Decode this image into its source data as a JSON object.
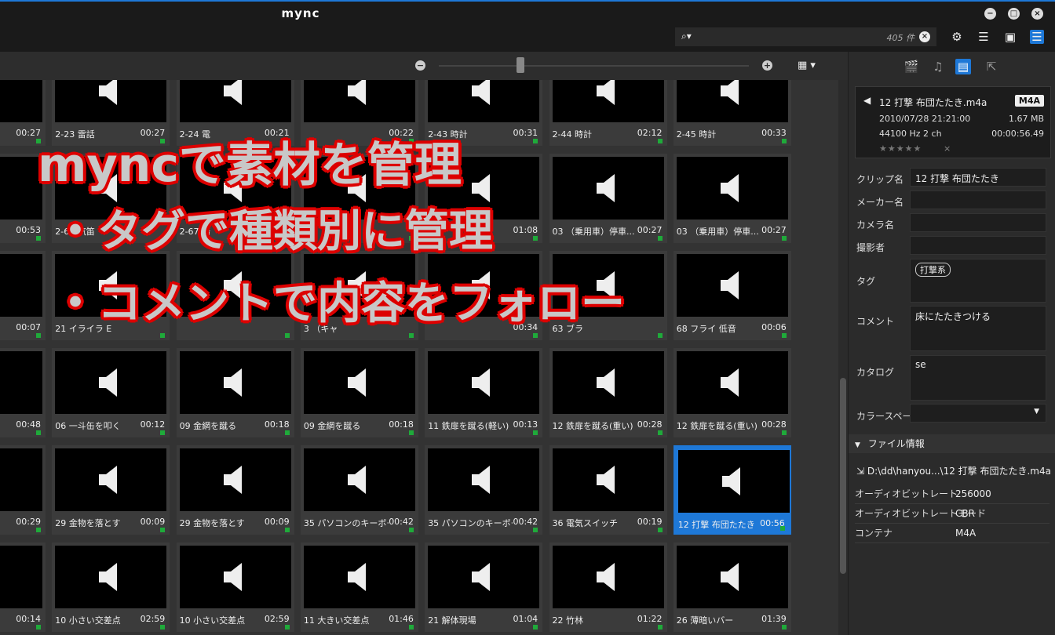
{
  "app": {
    "title": "mync"
  },
  "search": {
    "count": "405 件"
  },
  "overlay": {
    "line1": "myncで素材を管理",
    "line2": "・タグで種類別に管理",
    "line3": "・コメントで内容をフォロー"
  },
  "clips": [
    {
      "name": "",
      "dur": "00:27"
    },
    {
      "name": "2-23 雷話",
      "dur": "00:27"
    },
    {
      "name": "2-24 電",
      "dur": "00:21"
    },
    {
      "name": "",
      "dur": "00:22"
    },
    {
      "name": "2-43 時計",
      "dur": "00:31"
    },
    {
      "name": "2-44 時計",
      "dur": "02:12"
    },
    {
      "name": "2-45 時計",
      "dur": "00:33"
    },
    {
      "name": "",
      "dur": "00:53"
    },
    {
      "name": "2-65 汽笛",
      "dur": ""
    },
    {
      "name": "2-67 踏",
      "dur": "00:37"
    },
    {
      "name": "",
      "dur": ""
    },
    {
      "name": "",
      "dur": "01:08"
    },
    {
      "name": "03 （乗用車）停車...",
      "dur": "00:27"
    },
    {
      "name": "03 （乗用車）停車...",
      "dur": "00:27"
    },
    {
      "name": "",
      "dur": "00:07"
    },
    {
      "name": "21 イライラ E",
      "dur": ""
    },
    {
      "name": "",
      "dur": ""
    },
    {
      "name": "3 （キャ",
      "dur": ""
    },
    {
      "name": "",
      "dur": "00:34"
    },
    {
      "name": "63 ブラ",
      "dur": ""
    },
    {
      "name": "68 フライ 低音",
      "dur": "00:06"
    },
    {
      "name": "",
      "dur": "00:48"
    },
    {
      "name": "06 一斗缶を叩く",
      "dur": "00:12"
    },
    {
      "name": "09 金網を蹴る",
      "dur": "00:18"
    },
    {
      "name": "09 金網を蹴る",
      "dur": "00:18"
    },
    {
      "name": "11 鉄扉を蹴る(軽い)",
      "dur": "00:13"
    },
    {
      "name": "12 鉄扉を蹴る(重い)",
      "dur": "00:28"
    },
    {
      "name": "12 鉄扉を蹴る(重い)",
      "dur": "00:28"
    },
    {
      "name": "",
      "dur": "00:29"
    },
    {
      "name": "29 金物を落とす",
      "dur": "00:09"
    },
    {
      "name": "29 金物を落とす",
      "dur": "00:09"
    },
    {
      "name": "35 パソコンのキーボード",
      "dur": "00:42"
    },
    {
      "name": "35 パソコンのキーボード",
      "dur": "00:42"
    },
    {
      "name": "36 電気スイッチ",
      "dur": "00:19"
    },
    {
      "name": "12 打撃 布団たたき",
      "dur": "00:56"
    },
    {
      "name": "ス",
      "dur": "00:14"
    },
    {
      "name": "10 小さい交差点",
      "dur": "02:59"
    },
    {
      "name": "10 小さい交差点",
      "dur": "02:59"
    },
    {
      "name": "11 大きい交差点",
      "dur": "01:46"
    },
    {
      "name": "21 解体現場",
      "dur": "01:04"
    },
    {
      "name": "22 竹林",
      "dur": "01:22"
    },
    {
      "name": "26 薄暗いバー",
      "dur": "01:39"
    }
  ],
  "info": {
    "filename": "12 打撃 布団たたき.m4a",
    "format": "M4A",
    "datetime": "2010/07/28 21:21:00",
    "size": "1.67 MB",
    "audio": "44100 Hz 2 ch",
    "duration": "00:00:56.49",
    "rating_stars": "★★★★★",
    "rating_clear": "×"
  },
  "meta": {
    "clip_label": "クリップ名",
    "clip_value": "12 打撃 布団たたき",
    "maker_label": "メーカー名",
    "camera_label": "カメラ名",
    "shooter_label": "撮影者",
    "tag_label": "タグ",
    "tag_value": "打撃系",
    "comment_label": "コメント",
    "comment_value": "床にたたきつける",
    "catalog_label": "カタログ",
    "catalog_value": "se",
    "colorspace_label": "カラースペース"
  },
  "fileinfo": {
    "section": "ファイル情報",
    "path": "D:\\dd\\hanyou...\\12 打撃 布団たたき.m4a",
    "rows": [
      {
        "label": "オーディオビットレート",
        "value": "256000"
      },
      {
        "label": "オーディオビットレートモード",
        "value": "CBR"
      },
      {
        "label": "コンテナ",
        "value": "M4A"
      }
    ]
  }
}
